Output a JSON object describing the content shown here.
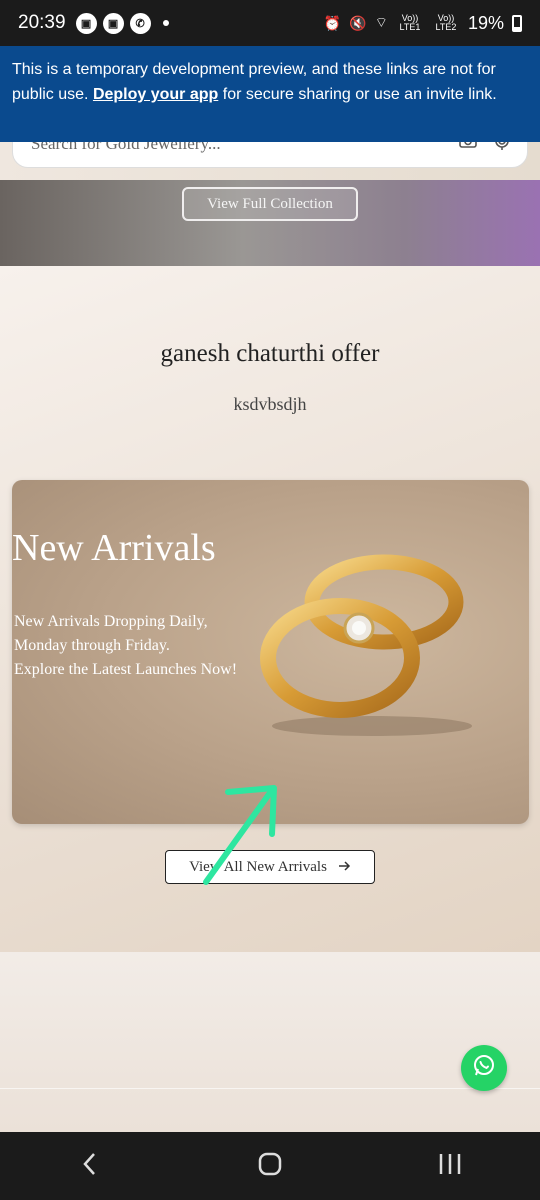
{
  "status_bar": {
    "time": "20:39",
    "battery": "19%",
    "sim1": "Vo)) LTE1",
    "sim2": "Vo)) LTE2"
  },
  "banner": {
    "text_before": "This is a temporary development preview, and these links are not for public use. ",
    "link_label": "Deploy your app",
    "text_after": " for secure sharing or use an invite link."
  },
  "search": {
    "placeholder": "Search for Gold Jewellery...",
    "camera_icon": "camera-icon",
    "mic_icon": "mic-icon"
  },
  "hero": {
    "button_label": "View Full Collection"
  },
  "offer": {
    "title": "ganesh chaturthi offer",
    "subtitle": "ksdvbsdjh"
  },
  "arrivals": {
    "title": "New Arrivals",
    "desc_line1": "New Arrivals Dropping Daily,",
    "desc_line2": "Monday through Friday.",
    "desc_line3": "Explore the Latest Launches Now!",
    "button_label": "View All New Arrivals",
    "button_icon": "arrow-right-icon"
  },
  "colors": {
    "banner_bg": "#0a4a8e",
    "whatsapp": "#25d366",
    "annotation_arrow": "#2ee6a0"
  },
  "nav": {
    "back_icon": "back-icon",
    "home_icon": "home-icon",
    "recents_icon": "recents-icon"
  }
}
